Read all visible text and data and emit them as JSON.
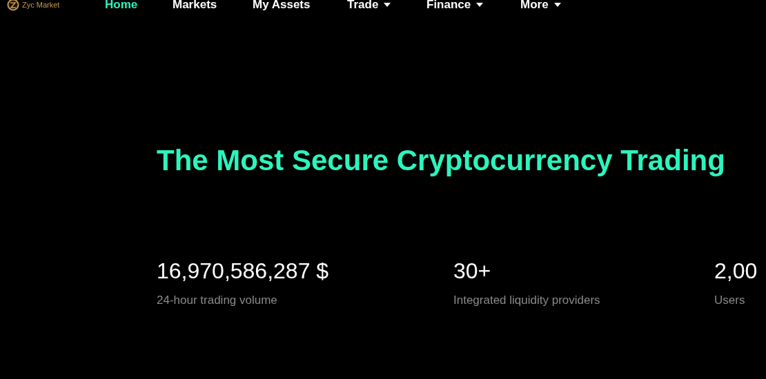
{
  "brand": {
    "name": "Zyc Market"
  },
  "nav": [
    {
      "label": "Home",
      "selected": true,
      "dropdown": false
    },
    {
      "label": "Markets",
      "selected": false,
      "dropdown": false
    },
    {
      "label": "My Assets",
      "selected": false,
      "dropdown": false
    },
    {
      "label": "Trade",
      "selected": false,
      "dropdown": true
    },
    {
      "label": "Finance",
      "selected": false,
      "dropdown": true
    },
    {
      "label": "More",
      "selected": false,
      "dropdown": true
    }
  ],
  "headline": "The Most Secure Cryptocurrency Trading",
  "stats": [
    {
      "value": "16,970,586,287 $",
      "label": "24-hour trading volume"
    },
    {
      "value": "30+",
      "label": "Integrated liquidity providers"
    },
    {
      "value": "2,00",
      "label": "Users"
    }
  ]
}
